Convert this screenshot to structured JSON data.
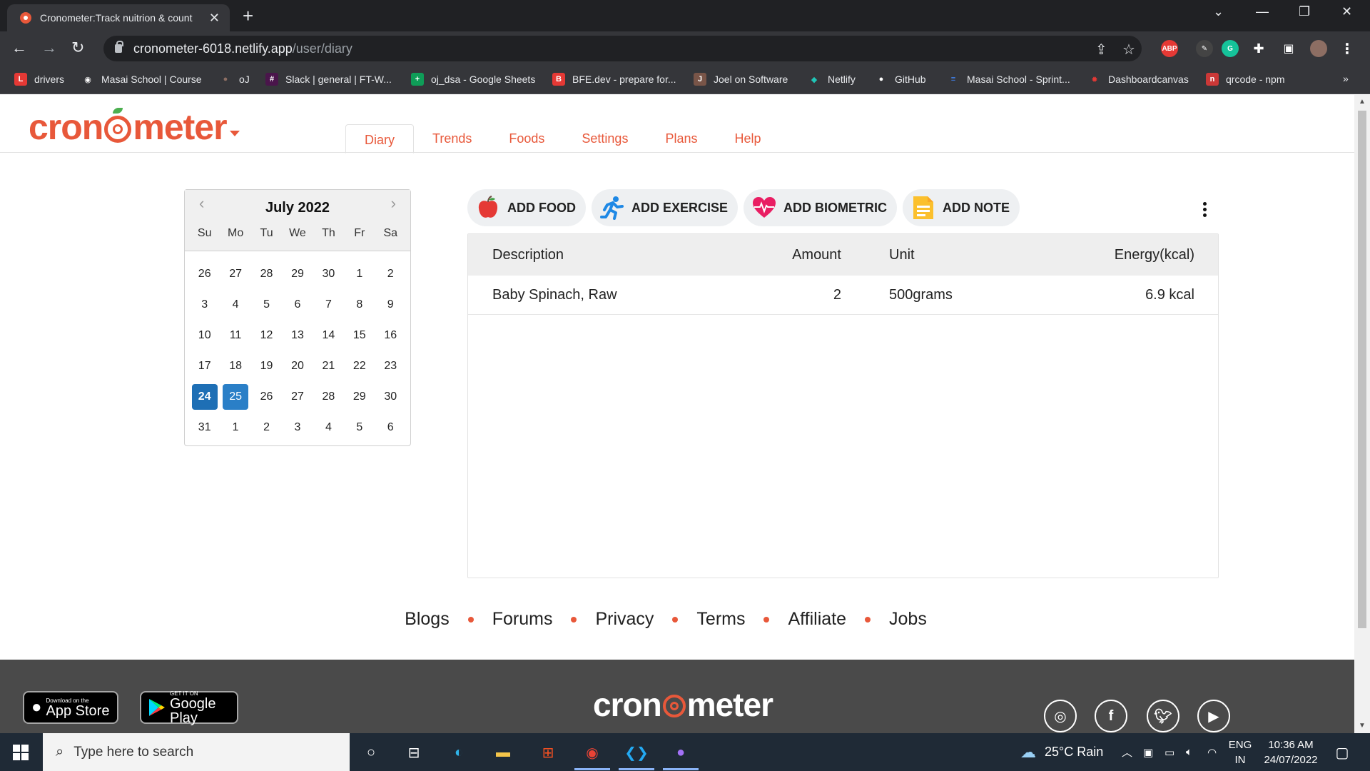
{
  "browser": {
    "tab_title": "Cronometer:Track nuitrion & count",
    "url_host": "cronometer-6018.netlify.app",
    "url_path": "/user/diary",
    "bookmarks": [
      {
        "label": "drivers",
        "icon_color": "#e53935",
        "glyph": "L"
      },
      {
        "label": "Masai School | Course",
        "icon_color": "#ffffff",
        "glyph": "◉"
      },
      {
        "label": "oJ",
        "icon_color": "#8d6e63",
        "glyph": "●"
      },
      {
        "label": "Slack | general | FT-W...",
        "icon_color": "#4a154b",
        "glyph": "#"
      },
      {
        "label": "oj_dsa - Google Sheets",
        "icon_color": "#0f9d58",
        "glyph": "+"
      },
      {
        "label": "BFE.dev - prepare for...",
        "icon_color": "#e53935",
        "glyph": "B"
      },
      {
        "label": "Joel on Software",
        "icon_color": "#795548",
        "glyph": "J"
      },
      {
        "label": "Netlify",
        "icon_color": "#20c6b7",
        "glyph": "◆"
      },
      {
        "label": "GitHub",
        "icon_color": "#ffffff",
        "glyph": "●"
      },
      {
        "label": "Masai School - Sprint...",
        "icon_color": "#4285f4",
        "glyph": "≡"
      },
      {
        "label": "Dashboardcanvas",
        "icon_color": "#e53935",
        "glyph": "✹"
      },
      {
        "label": "qrcode - npm",
        "icon_color": "#cb3837",
        "glyph": "n"
      }
    ],
    "more_bookmarks": "»",
    "ext_abp": "ABP"
  },
  "app": {
    "logo_text_1": "cron",
    "logo_text_2": "meter",
    "brand_color": "#e8583a",
    "nav": [
      "Diary",
      "Trends",
      "Foods",
      "Settings",
      "Plans",
      "Help"
    ],
    "active_nav": "Diary"
  },
  "calendar": {
    "title": "July 2022",
    "prev": "‹",
    "next": "›",
    "weekdays": [
      "Su",
      "Mo",
      "Tu",
      "We",
      "Th",
      "Fr",
      "Sa"
    ],
    "weeks": [
      [
        "26",
        "27",
        "28",
        "29",
        "30",
        "1",
        "2"
      ],
      [
        "3",
        "4",
        "5",
        "6",
        "7",
        "8",
        "9"
      ],
      [
        "10",
        "11",
        "12",
        "13",
        "14",
        "15",
        "16"
      ],
      [
        "17",
        "18",
        "19",
        "20",
        "21",
        "22",
        "23"
      ],
      [
        "24",
        "25",
        "26",
        "27",
        "28",
        "29",
        "30"
      ],
      [
        "31",
        "1",
        "2",
        "3",
        "4",
        "5",
        "6"
      ]
    ],
    "today": "24",
    "selected": "25"
  },
  "actions": {
    "add_food": "ADD FOOD",
    "add_exercise": "ADD EXERCISE",
    "add_biometric": "ADD BIOMETRIC",
    "add_note": "ADD NOTE"
  },
  "diary": {
    "headers": {
      "description": "Description",
      "amount": "Amount",
      "unit": "Unit",
      "energy": "Energy(kcal)"
    },
    "rows": [
      {
        "description": "Baby Spinach, Raw",
        "amount": "2",
        "unit": "500grams",
        "energy": "6.9 kcal"
      }
    ]
  },
  "footer": {
    "links": [
      "Blogs",
      "Forums",
      "Privacy",
      "Terms",
      "Affiliate",
      "Jobs"
    ],
    "app_store_small": "Download on the",
    "app_store_big": "App Store",
    "play_small": "GET IT ON",
    "play_big": "Google Play"
  },
  "taskbar": {
    "search_placeholder": "Type here to search",
    "weather": "25°C  Rain",
    "lang_1": "ENG",
    "lang_2": "IN",
    "time": "10:36 AM",
    "date": "24/07/2022"
  }
}
